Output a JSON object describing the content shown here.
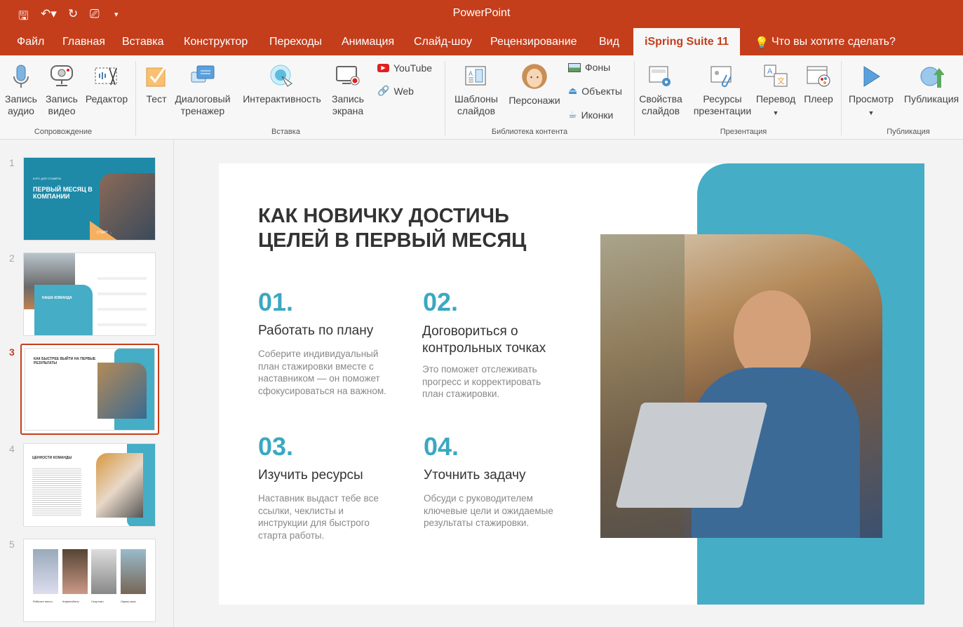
{
  "app": {
    "title": "PowerPoint"
  },
  "tabs": [
    "Файл",
    "Главная",
    "Вставка",
    "Конструктор",
    "Переходы",
    "Анимация",
    "Слайд-шоу",
    "Рецензирование",
    "Вид",
    "iSpring Suite 11"
  ],
  "tell_me": "Что вы хотите сделать?",
  "ribbon": {
    "record_audio": "Запись аудио",
    "record_video": "Запись видео",
    "editor": "Редактор",
    "group_narration": "Сопровождение",
    "quiz": "Тест",
    "dialog_sim": "Диалоговый тренажер",
    "interactivity": "Интерактивность",
    "screen_record": "Запись экрана",
    "youtube": "YouTube",
    "web": "Web",
    "group_insert": "Вставка",
    "slide_templates": "Шаблоны слайдов",
    "characters": "Персонажи",
    "backgrounds": "Фоны",
    "objects": "Объекты",
    "icons": "Иконки",
    "group_library": "Библиотека контента",
    "slide_props": "Свойства слайдов",
    "resources": "Ресурсы презентации",
    "translate": "Перевод",
    "player": "Плеер",
    "group_presentation": "Презентация",
    "preview": "Просмотр",
    "publish": "Публикация",
    "group_publish": "Публикация"
  },
  "thumbnails": [
    {
      "num": "1",
      "kicker": "КУРС ДЛЯ СТАЖЁРА",
      "title": "ПЕРВЫЙ МЕСЯЦ В КОМПАНИИ",
      "button": "СТАРТ →"
    },
    {
      "num": "2",
      "title": "НАША КОМАНДА"
    },
    {
      "num": "3",
      "title": "КАК БЫСТРЕЕ ВЫЙТИ НА ПЕРВЫЕ РЕЗУЛЬТАТЫ"
    },
    {
      "num": "4",
      "title": "ЦЕННОСТИ КОМАНДЫ"
    },
    {
      "num": "5",
      "labels": [
        "Рабочее место",
        "Кофепойнты",
        "Спортзал",
        "Лаунж-зона"
      ]
    }
  ],
  "slide": {
    "title_line1": "КАК НОВИЧКУ ДОСТИЧЬ",
    "title_line2": "ЦЕЛЕЙ В ПЕРВЫЙ МЕСЯЦ",
    "steps": [
      {
        "num": "01.",
        "heading": "Работать по плану",
        "body": "Соберите индивидуальный план стажировки вместе с наставником — он поможет сфокусироваться на важном."
      },
      {
        "num": "02.",
        "heading": "Договориться о контрольных точках",
        "body": "Это поможет отслеживать прогресс и корректировать план стажировки."
      },
      {
        "num": "03.",
        "heading": "Изучить ресурсы",
        "body": "Наставник выдаст тебе все ссылки, чеклисты и инструкции для быстрого старта работы."
      },
      {
        "num": "04.",
        "heading": "Уточнить задачу",
        "body": "Обсуди с руководителем ключевые цели и ожидаемые результаты стажировки."
      }
    ]
  },
  "colors": {
    "accent": "#c43e1c",
    "teal": "#45adc6"
  }
}
